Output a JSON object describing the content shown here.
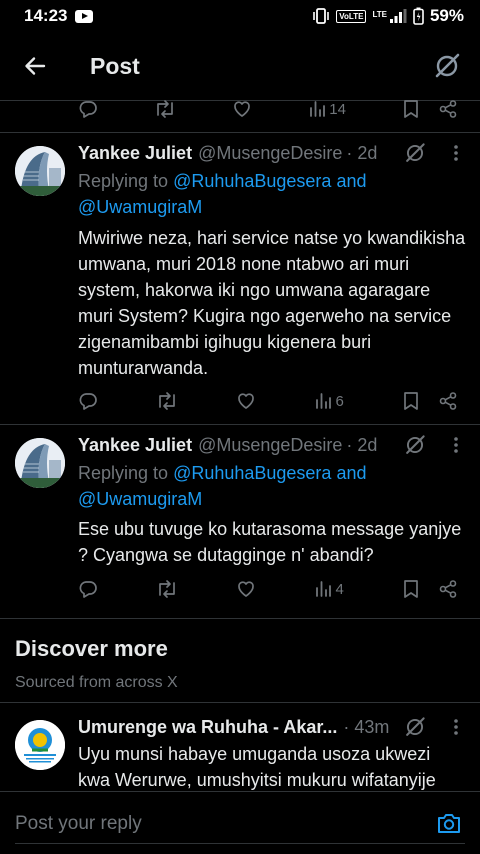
{
  "status_bar": {
    "time": "14:23",
    "network": "VoLTE",
    "lte": "LTE",
    "battery": "59%"
  },
  "header": {
    "title": "Post"
  },
  "top_actions": {
    "views": "14"
  },
  "tweets": [
    {
      "name": "Yankee Juliet",
      "handle": "@MusengeDesire",
      "time": "· 2d",
      "replying_prefix": "Replying to ",
      "reply_to_1": "@RuhuhaBugesera",
      "reply_and": " and",
      "reply_to_2": "@UwamugiraM",
      "text": "Mwiriwe neza, hari service natse yo kwandikisha umwana, muri 2018 none ntabwo ari muri system, hakorwa iki ngo umwana agaragare muri System? Kugira ngo agerweho na service zigenamibambi igihugu kigenera buri munturarwanda.",
      "views": "6"
    },
    {
      "name": "Yankee Juliet",
      "handle": "@MusengeDesire",
      "time": "· 2d",
      "replying_prefix": "Replying to ",
      "reply_to_1": "@RuhuhaBugesera",
      "reply_and": " and",
      "reply_to_2": "@UwamugiraM",
      "text": "Ese ubu tuvuge ko kutarasoma message yanjye ?  Cyangwa se dutagginge n' abandi?",
      "views": "4"
    }
  ],
  "discover": {
    "title": "Discover more",
    "subtitle": "Sourced from across X"
  },
  "discover_tweet": {
    "name": "Umurenge wa Ruhuha - Akar...",
    "time": "· 43m",
    "text": "Uyu munsi habaye umuganda usoza ukwezi kwa Werurwe, umushyitsi mukuru wifatanyije"
  },
  "reply_bar": {
    "placeholder": "Post your reply"
  },
  "colors": {
    "background": "#000000",
    "link": "#1d9bf0",
    "muted": "#71767b",
    "divider": "#2f3336"
  }
}
